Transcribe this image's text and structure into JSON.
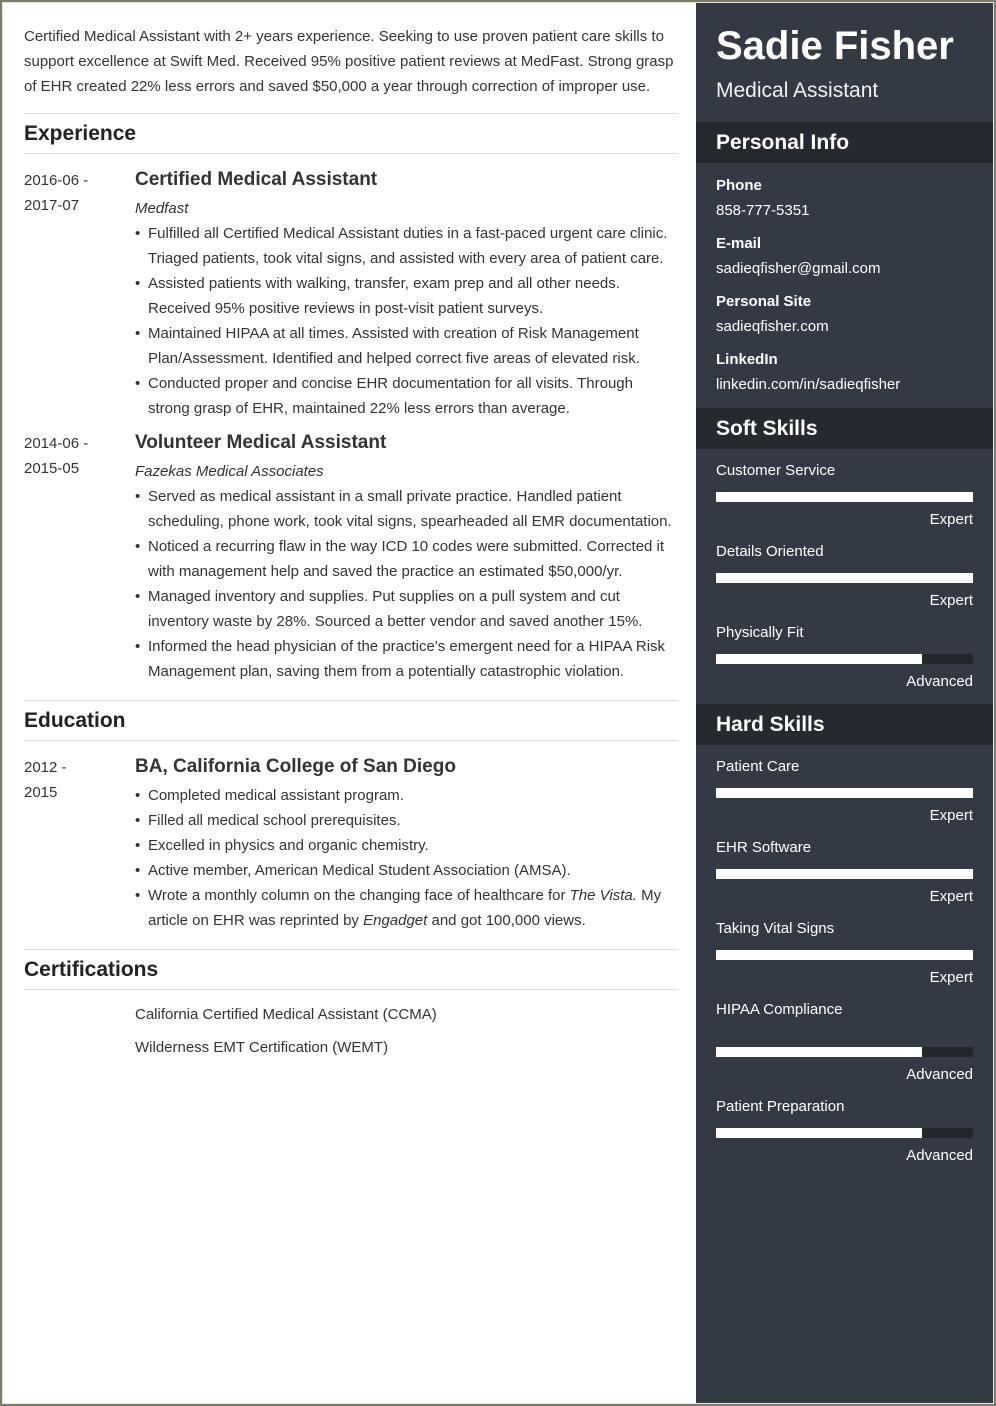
{
  "header": {
    "name": "Sadie Fisher",
    "role": "Medical Assistant"
  },
  "summary": "Certified Medical Assistant with 2+ years experience. Seeking to use proven patient care skills to support excellence at Swift Med. Received 95% positive patient reviews at MedFast. Strong grasp of EHR created 22% less errors and saved $50,000 a year through correction of improper use.",
  "experience": {
    "heading": "Experience",
    "entries": [
      {
        "date_start": "2016-06 -",
        "date_end": "2017-07",
        "title": "Certified Medical Assistant",
        "org": "Medfast",
        "bullets": [
          "Fulfilled all Certified Medical Assistant duties in a fast-paced urgent care clinic. Triaged patients, took vital signs, and assisted with every area of patient care.",
          "Assisted patients with walking, transfer, exam prep and all other needs. Received 95% positive reviews in post-visit patient surveys.",
          "Maintained HIPAA at all times. Assisted with creation of Risk Management Plan/Assessment. Identified and helped correct five areas of elevated risk.",
          "Conducted proper and concise EHR documentation for all visits. Through strong grasp of EHR, maintained 22% less errors than average."
        ]
      },
      {
        "date_start": "2014-06 -",
        "date_end": "2015-05",
        "title": "Volunteer Medical Assistant",
        "org": "Fazekas Medical Associates",
        "bullets": [
          "Served as medical assistant in a small private practice. Handled patient scheduling, phone work, took vital signs, spearheaded all EMR documentation.",
          "Noticed a recurring flaw in the way ICD 10 codes were submitted. Corrected it with management help and saved the practice an estimated $50,000/yr.",
          "Managed inventory and supplies. Put supplies on a pull system and cut inventory waste by 28%. Sourced a better vendor and saved another 15%.",
          "Informed the head physician of the practice's emergent need for a HIPAA Risk Management plan, saving them from a potentially catastrophic violation."
        ]
      }
    ]
  },
  "education": {
    "heading": "Education",
    "entries": [
      {
        "date_start": "2012 -",
        "date_end": "2015",
        "title": "BA, California College of San Diego",
        "bullets": [
          "Completed medical assistant program.",
          "Filled all medical school prerequisites.",
          "Excelled in physics and organic chemistry.",
          "Active member, American Medical Student Association (AMSA)."
        ],
        "last_bullet": {
          "part1": "Wrote a monthly column on the changing face of healthcare for ",
          "italic1": "The Vista.",
          "part2": " My article on EHR was reprinted by ",
          "italic2": "Engadget",
          "part3": " and got 100,000 views."
        }
      }
    ]
  },
  "certifications": {
    "heading": "Certifications",
    "items": [
      "California Certified Medical Assistant (CCMA)",
      "Wilderness EMT Certification (WEMT)"
    ]
  },
  "personal_info": {
    "heading": "Personal Info",
    "fields": [
      {
        "label": "Phone",
        "value": "858-777-5351"
      },
      {
        "label": "E-mail",
        "value": "sadieqfisher@gmail.com"
      },
      {
        "label": "Personal Site",
        "value": "sadieqfisher.com"
      },
      {
        "label": "LinkedIn",
        "value": "linkedin.com/in/sadieqfisher"
      }
    ]
  },
  "soft_skills": {
    "heading": "Soft Skills",
    "items": [
      {
        "name": "Customer Service",
        "level": "Expert",
        "fill_percent": 100
      },
      {
        "name": "Details Oriented",
        "level": "Expert",
        "fill_percent": 100
      },
      {
        "name": "Physically Fit",
        "level": "Advanced",
        "fill_percent": 80
      }
    ]
  },
  "hard_skills": {
    "heading": "Hard Skills",
    "items": [
      {
        "name": "Patient Care",
        "level": "Expert",
        "fill_percent": 100
      },
      {
        "name": "EHR Software",
        "level": "Expert",
        "fill_percent": 100
      },
      {
        "name": "Taking Vital Signs",
        "level": "Expert",
        "fill_percent": 100
      },
      {
        "name": "HIPAA Compliance",
        "level": "Advanced",
        "fill_percent": 80
      },
      {
        "name": "Patient Preparation",
        "level": "Advanced",
        "fill_percent": 80
      }
    ]
  },
  "colors": {
    "sidebar_bg": "#343a44",
    "sidebar_heading_bg": "#252930",
    "bar_track": "#22262d",
    "bar_fill": "#ffffff",
    "page_border": "#7d7c68"
  }
}
